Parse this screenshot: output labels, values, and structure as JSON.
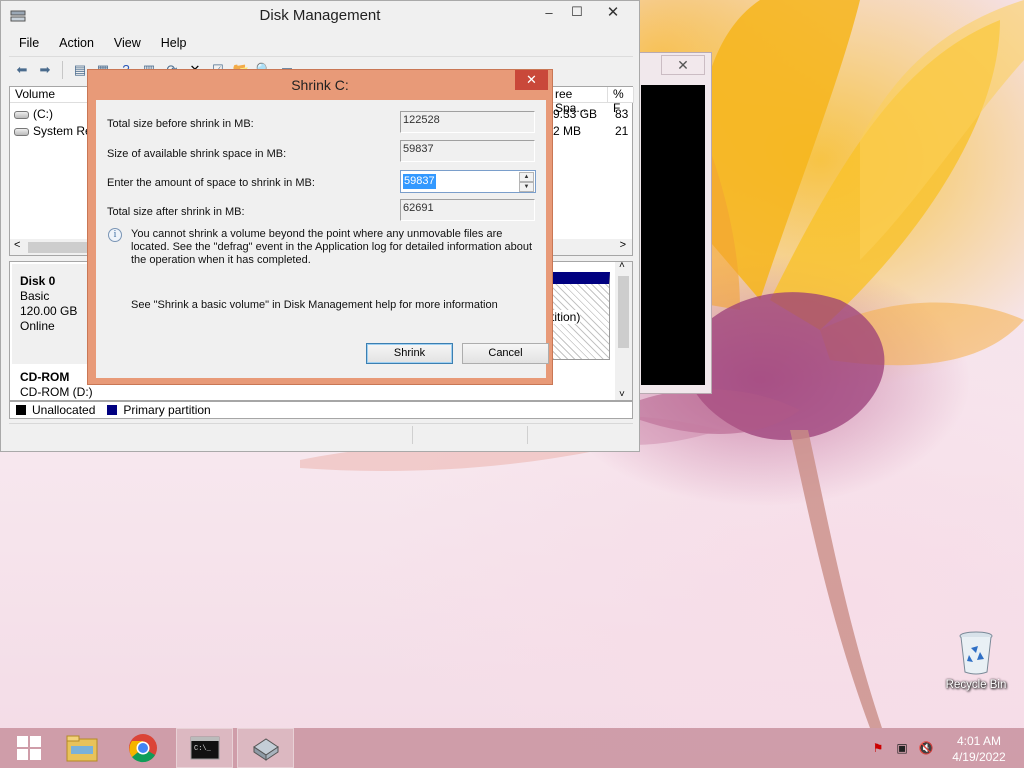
{
  "disk_management": {
    "title": "Disk Management",
    "menu": [
      "File",
      "Action",
      "View",
      "Help"
    ],
    "columns": {
      "volume": "Volume",
      "free_space": "ree Spa...",
      "percent_free": "% F"
    },
    "volumes": [
      {
        "name": "(C:)",
        "free_space": "9.33 GB",
        "percent_free": "83"
      },
      {
        "name": "System Res",
        "free_space": "2 MB",
        "percent_free": "21"
      }
    ],
    "disk0": {
      "name": "Disk 0",
      "type": "Basic",
      "size": "120.00 GB",
      "status": "Online",
      "partition_text": "tition)"
    },
    "cdrom": {
      "name": "CD-ROM",
      "drive": "CD-ROM (D:)"
    },
    "legend": {
      "unallocated": "Unallocated",
      "primary": "Primary partition",
      "unallocated_color": "#000000",
      "primary_color": "#000080"
    }
  },
  "shrink_dialog": {
    "title": "Shrink C:",
    "total_before_label": "Total size before shrink in MB:",
    "total_before_value": "122528",
    "available_label": "Size of available shrink space in MB:",
    "available_value": "59837",
    "amount_label": "Enter the amount of space to shrink in MB:",
    "amount_value": "59837",
    "total_after_label": "Total size after shrink in MB:",
    "total_after_value": "62691",
    "info_text": "You cannot shrink a volume beyond the point where any unmovable files are located. See the \"defrag\" event in the Application log for detailed information about the operation when it has completed.",
    "help_text": "See \"Shrink a basic volume\" in Disk Management help for more information",
    "shrink_label": "Shrink",
    "cancel_label": "Cancel"
  },
  "desktop": {
    "recycle_bin_label": "Recycle Bin"
  },
  "taskbar": {
    "apps": [
      "start-icon",
      "file-explorer-icon",
      "chrome-icon",
      "command-prompt-icon",
      "disk-management-icon"
    ],
    "time": "4:01 AM",
    "date": "4/19/2022"
  }
}
